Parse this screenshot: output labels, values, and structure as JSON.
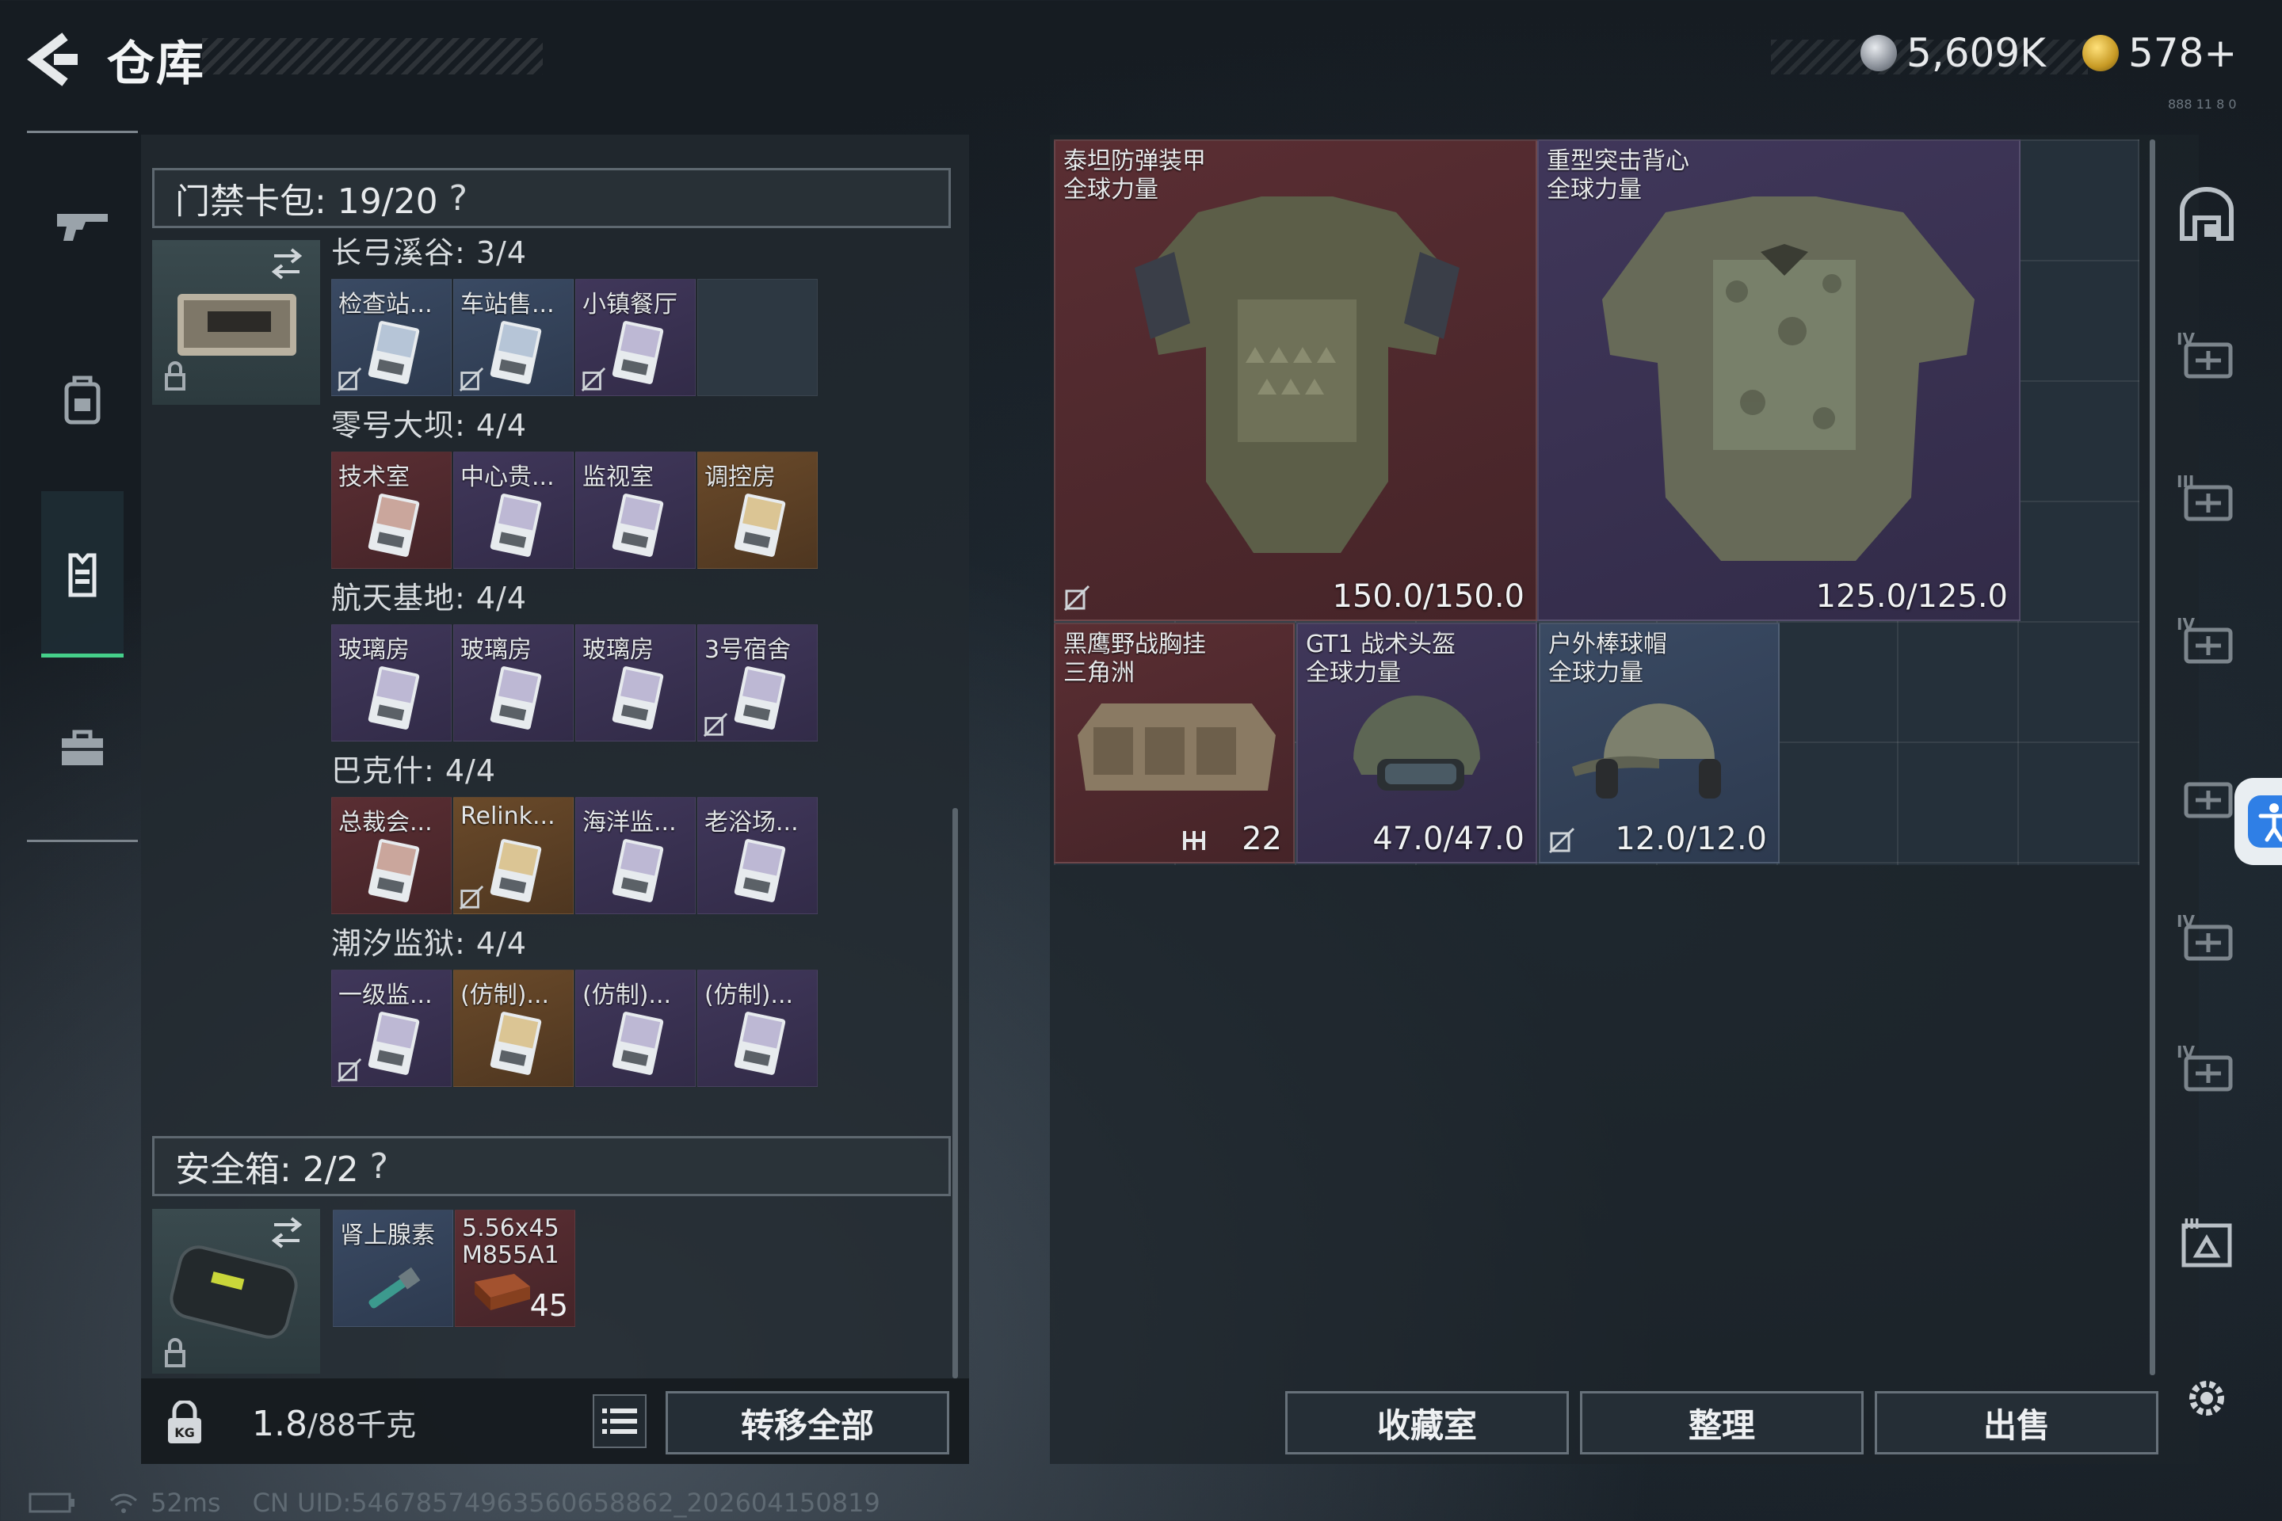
{
  "header": {
    "title": "仓库",
    "currency1": "5,609K",
    "currency2": "578+",
    "build": "888 11 8 0"
  },
  "left_rail": {
    "items": [
      {
        "icon": "rifle-icon"
      },
      {
        "icon": "backpack-icon"
      },
      {
        "icon": "vest-icon",
        "active": true
      },
      {
        "icon": "briefcase-icon"
      }
    ]
  },
  "keycard_section": {
    "label": "门禁卡包: 19/20",
    "help": "?",
    "groups": [
      {
        "name": "长弓溪谷: 3/4",
        "cells": [
          {
            "label": "检查站...",
            "color": "blue",
            "nosell": true
          },
          {
            "label": "车站售...",
            "color": "blue",
            "nosell": true
          },
          {
            "label": "小镇餐厅",
            "color": "purple",
            "nosell": true
          },
          {
            "label": "",
            "color": "gray"
          }
        ]
      },
      {
        "name": "零号大坝: 4/4",
        "cells": [
          {
            "label": "技术室",
            "color": "red"
          },
          {
            "label": "中心贵...",
            "color": "purple"
          },
          {
            "label": "监视室",
            "color": "purple"
          },
          {
            "label": "调控房",
            "color": "gold"
          }
        ]
      },
      {
        "name": "航天基地: 4/4",
        "cells": [
          {
            "label": "玻璃房",
            "color": "purple"
          },
          {
            "label": "玻璃房",
            "color": "purple"
          },
          {
            "label": "玻璃房",
            "color": "purple"
          },
          {
            "label": "3号宿舍",
            "color": "purple",
            "nosell": true
          }
        ]
      },
      {
        "name": "巴克什: 4/4",
        "cells": [
          {
            "label": "总裁会...",
            "color": "red"
          },
          {
            "label": "Relink...",
            "color": "gold",
            "nosell": true
          },
          {
            "label": "海洋监...",
            "color": "purple"
          },
          {
            "label": "老浴场...",
            "color": "purple"
          }
        ]
      },
      {
        "name": "潮汐监狱: 4/4",
        "cells": [
          {
            "label": "一级监...",
            "color": "purple",
            "nosell": true
          },
          {
            "label": "(仿制)...",
            "color": "gold"
          },
          {
            "label": "(仿制)...",
            "color": "purple"
          },
          {
            "label": "(仿制)...",
            "color": "purple"
          }
        ]
      }
    ]
  },
  "safe_section": {
    "label": "安全箱: 2/2",
    "help": "?",
    "cells": [
      {
        "label": "肾上腺素",
        "color": "blue"
      },
      {
        "label": "5.56x45\nM855A1",
        "count": "45",
        "color": "red"
      }
    ]
  },
  "bottom": {
    "weight": "1.8",
    "weight_cap": "/88千克",
    "transfer_label": "转移全部"
  },
  "equipment": [
    {
      "name": "泰坦防弹装甲\n全球力量",
      "durability": "150.0/150.0",
      "color": "red",
      "nosell": true
    },
    {
      "name": "重型突击背心\n全球力量",
      "durability": "125.0/125.0",
      "color": "purple"
    },
    {
      "name": "黑鹰野战胸挂\n三角洲",
      "durability": "22",
      "color": "red",
      "capacity_icon": true
    },
    {
      "name": "GT1 战术头盔\n全球力量",
      "durability": "47.0/47.0",
      "color": "purple"
    },
    {
      "name": "户外棒球帽\n全球力量",
      "durability": "12.0/12.0",
      "color": "blue",
      "nosell": true
    }
  ],
  "actions": {
    "collection": "收藏室",
    "sort": "整理",
    "sell": "出售"
  },
  "right_rail": {
    "labels": [
      "",
      "IV",
      "III",
      "IV",
      "",
      "IV",
      "IV",
      "III",
      ""
    ]
  },
  "status": {
    "ping": "52ms",
    "uid": "CN UID:5467857496356065886​2_202604150819"
  }
}
